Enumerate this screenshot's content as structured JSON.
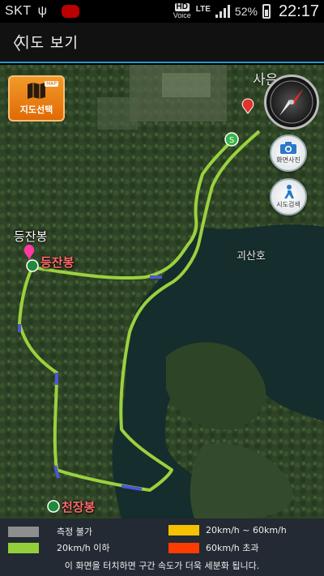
{
  "statusbar": {
    "carrier": "SKT",
    "usb_icon": "ψ",
    "hd_label": "HD",
    "voice_label": "Voice",
    "network": "LTE",
    "battery_percent": "52%",
    "battery_level": 0.52,
    "time": "22:17"
  },
  "header": {
    "back_glyph": "〈",
    "title": "지도 보기"
  },
  "map": {
    "map_select_label": "지도선택",
    "map_select_tag": "MAP",
    "photo_label": "화면사진",
    "draw_label": "시도검색",
    "labels": {
      "peak_marker": "등잔봉",
      "peak_red": "등잔봉",
      "end_peak": "천장봉",
      "lake": "괴산호",
      "village": "사은"
    }
  },
  "legend": {
    "items": [
      {
        "label": "측정 불가",
        "color": "#8e8e8e"
      },
      {
        "label": "20km/h 이하",
        "color": "#93cf3a"
      },
      {
        "label": "20km/h ~ 60km/h",
        "color": "#f5c100"
      },
      {
        "label": "60km/h 초과",
        "color": "#ff3c00"
      }
    ],
    "note": "이 화면을 터치하면 구간 속도가 더욱 세분화 됩니다."
  },
  "colors": {
    "route": "#9bd13e",
    "route_alt": "#4d56d8",
    "accent": "#1e9ad0",
    "map_select": "#ef8417"
  }
}
